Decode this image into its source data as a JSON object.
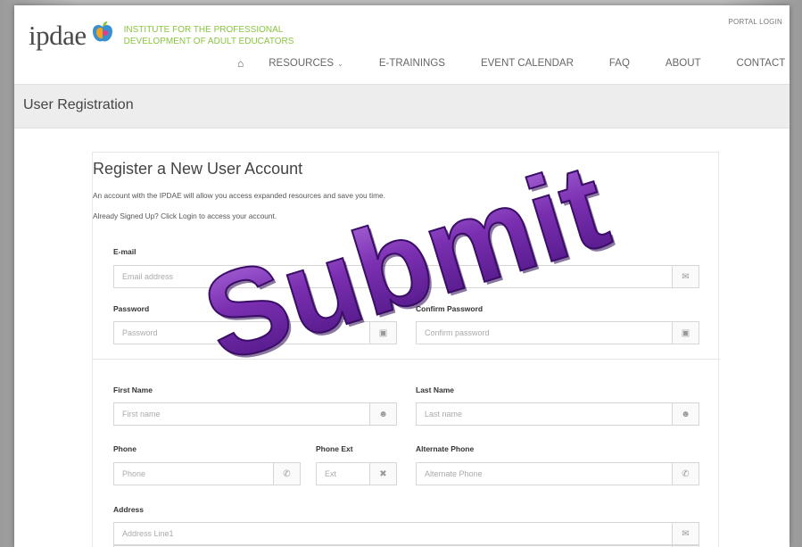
{
  "header": {
    "logo_word": "ipdae",
    "tagline_line1": "INSTITUTE FOR THE PROFESSIONAL",
    "tagline_line2": "DEVELOPMENT OF ADULT EDUCATORS",
    "portal_login": "PORTAL LOGIN",
    "brand_color": "#8ac540"
  },
  "nav": {
    "home_icon": "home-icon",
    "items": [
      {
        "label": "RESOURCES",
        "has_dropdown": true
      },
      {
        "label": "E-TRAININGS"
      },
      {
        "label": "EVENT CALENDAR"
      },
      {
        "label": "FAQ"
      },
      {
        "label": "ABOUT"
      },
      {
        "label": "CONTACT"
      }
    ]
  },
  "page": {
    "title": "User Registration"
  },
  "form": {
    "heading": "Register a New User Account",
    "intro1": "An account with the IPDAE will allow you access expanded resources and save you time.",
    "intro2": "Already Signed Up? Click Login to access your account.",
    "email": {
      "label": "E-mail",
      "placeholder": "Email address",
      "icon": "envelope-icon"
    },
    "password": {
      "label": "Password",
      "placeholder": "Password",
      "icon": "lock-icon"
    },
    "confirm_password": {
      "label": "Confirm Password",
      "placeholder": "Confirm password",
      "icon": "lock-icon"
    },
    "first_name": {
      "label": "First Name",
      "placeholder": "First name",
      "icon": "user-icon"
    },
    "last_name": {
      "label": "Last Name",
      "placeholder": "Last name",
      "icon": "user-icon"
    },
    "phone": {
      "label": "Phone",
      "placeholder": "Phone",
      "icon": "phone-icon"
    },
    "phone_ext": {
      "label": "Phone Ext",
      "placeholder": "Ext",
      "icon": "close-icon"
    },
    "alt_phone": {
      "label": "Alternate Phone",
      "placeholder": "Alternate Phone",
      "icon": "phone-icon"
    },
    "address": {
      "label": "Address",
      "placeholder": "Address Line1",
      "icon": "envelope-icon"
    }
  },
  "overlay": {
    "word": "Submit",
    "color": "#7a2fb0"
  }
}
